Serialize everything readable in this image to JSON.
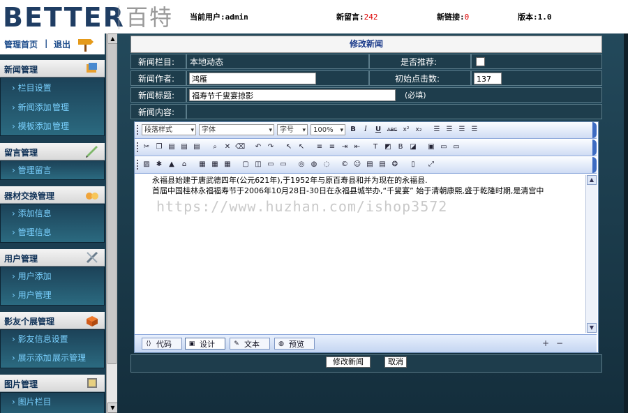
{
  "header": {
    "logo_en": "BETTER",
    "logo_cn": "百特",
    "current_user_label": "当前用户:",
    "current_user": "admin",
    "new_messages_label": "新留言:",
    "new_messages": "242",
    "new_links_label": "新链接:",
    "new_links": "0",
    "version_label": "版本:",
    "version": "1.0"
  },
  "sidebar": {
    "home": "管理首页",
    "separator": "|",
    "logout": "退出",
    "sections": [
      {
        "title": "新闻管理",
        "items": [
          "栏目设置",
          "新闻添加",
          "管理",
          "模板添加",
          "管理"
        ]
      },
      {
        "title": "留言管理",
        "items": [
          "管理留言"
        ]
      },
      {
        "title": "器材交换管理",
        "items": [
          "添加信息",
          "管理信息"
        ]
      },
      {
        "title": "用户管理",
        "items": [
          "用户添加",
          "用户管理"
        ]
      },
      {
        "title": "影友个展管理",
        "items": [
          "影友信息设置",
          "展示添加",
          "展示管理"
        ]
      },
      {
        "title": "图片管理",
        "items": [
          "图片栏目"
        ]
      }
    ]
  },
  "form": {
    "title": "修改新闻",
    "category_label": "新闻栏目:",
    "category_value": "本地动态",
    "recommend_label": "是否推荐:",
    "author_label": "新闻作者:",
    "author_value": "鸿雁",
    "clicks_label": "初始点击数:",
    "clicks_value": "137",
    "headline_label": "新闻标题:",
    "headline_value": "福寿节千叟宴掠影",
    "required_hint": "(必填)",
    "content_label": "新闻内容:"
  },
  "editor": {
    "toolbar1": {
      "paragraph_style": "段落样式",
      "font": "字体",
      "font_size": "字号",
      "zoom": "100%",
      "bold": "B",
      "italic": "I",
      "underline": "U",
      "strike": "ABC",
      "sup": "x²",
      "sub": "x₂"
    },
    "content_lines": [
      "永福县始建于唐武德四年(公元621年),于1952年与原百寿县和并为现在的永福县.",
      "首届中国桂林永福福寿节于2006年10月28日-30日在永福县城举办,“千叟宴” 始于清朝康熙,盛于乾隆时期,是清宫中"
    ],
    "watermark": "https://www.huzhan.com/ishop3572",
    "modes": [
      "代码",
      "设计",
      "文本",
      "预览"
    ],
    "active_mode": "设计",
    "zoom_in": "+",
    "zoom_out": "−"
  },
  "footer": {
    "submit": "修改新闻",
    "cancel": "取消"
  }
}
